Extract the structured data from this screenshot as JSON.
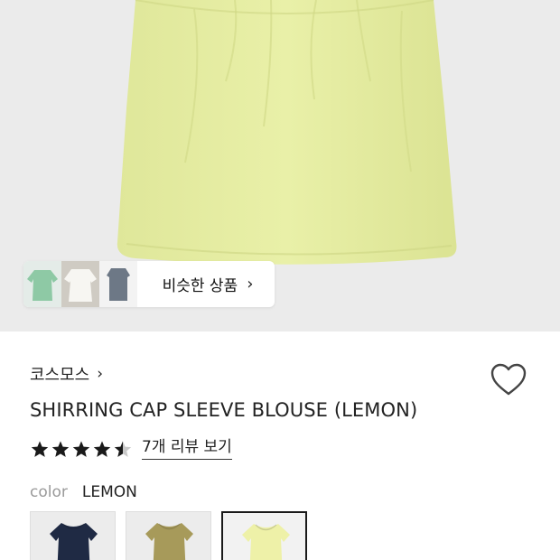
{
  "hero": {
    "garment_color": "#e6ee9c",
    "background_color": "#ebebeb"
  },
  "similar_products": {
    "label": "비슷한 상품",
    "chevron_icon": "chevron-right-icon",
    "thumbnails": [
      "green-blouse-thumbnail",
      "white-blouse-thumbnail",
      "grey-blouse-thumbnail"
    ]
  },
  "product": {
    "brand": "코스모스",
    "brand_chevron_icon": "chevron-right-icon",
    "title": "SHIRRING CAP SLEEVE BLOUSE (LEMON)",
    "wishlist_icon": "heart-outline-icon",
    "rating": 4.5,
    "rating_max": 5,
    "review_link": "7개 리뷰 보기",
    "color_label": "color",
    "color_value": "LEMON",
    "color_options": [
      {
        "name": "navy",
        "hex": "#1f2a44",
        "selected": false
      },
      {
        "name": "olive",
        "hex": "#a79a5a",
        "selected": false
      },
      {
        "name": "lemon",
        "hex": "#eef1a8",
        "selected": true
      }
    ]
  }
}
